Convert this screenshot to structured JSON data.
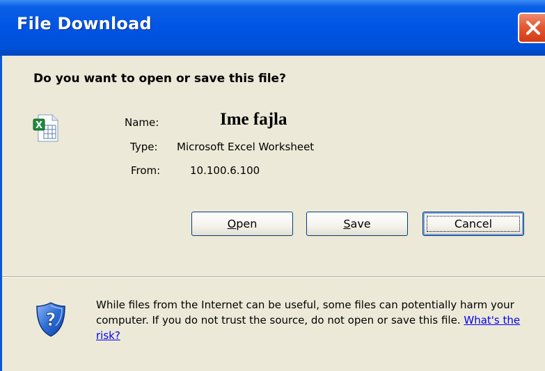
{
  "window": {
    "title": "File Download",
    "close_icon": "close-icon"
  },
  "dialog": {
    "question": "Do you want to open or save this file?",
    "file_icon": "excel-file-icon",
    "name_label": "Name:",
    "name_value": "Ime fajla",
    "type_label": "Type:",
    "type_value": "Microsoft Excel Worksheet",
    "from_label": "From:",
    "from_value": "10.100.6.100"
  },
  "buttons": {
    "open": {
      "mnemonic": "O",
      "rest": "pen"
    },
    "save": {
      "mnemonic": "S",
      "rest": "ave"
    },
    "cancel": "Cancel"
  },
  "warning": {
    "icon": "shield-question-icon",
    "text": "While files from the Internet can be useful, some files can potentially harm your computer. If you do not trust the source, do not open or save this file. ",
    "link": "What's the risk?"
  },
  "colors": {
    "titlebar": "#0054e3",
    "dialog_bg": "#ece9d8",
    "close_button": "#e35a34",
    "link": "#0000ee"
  }
}
